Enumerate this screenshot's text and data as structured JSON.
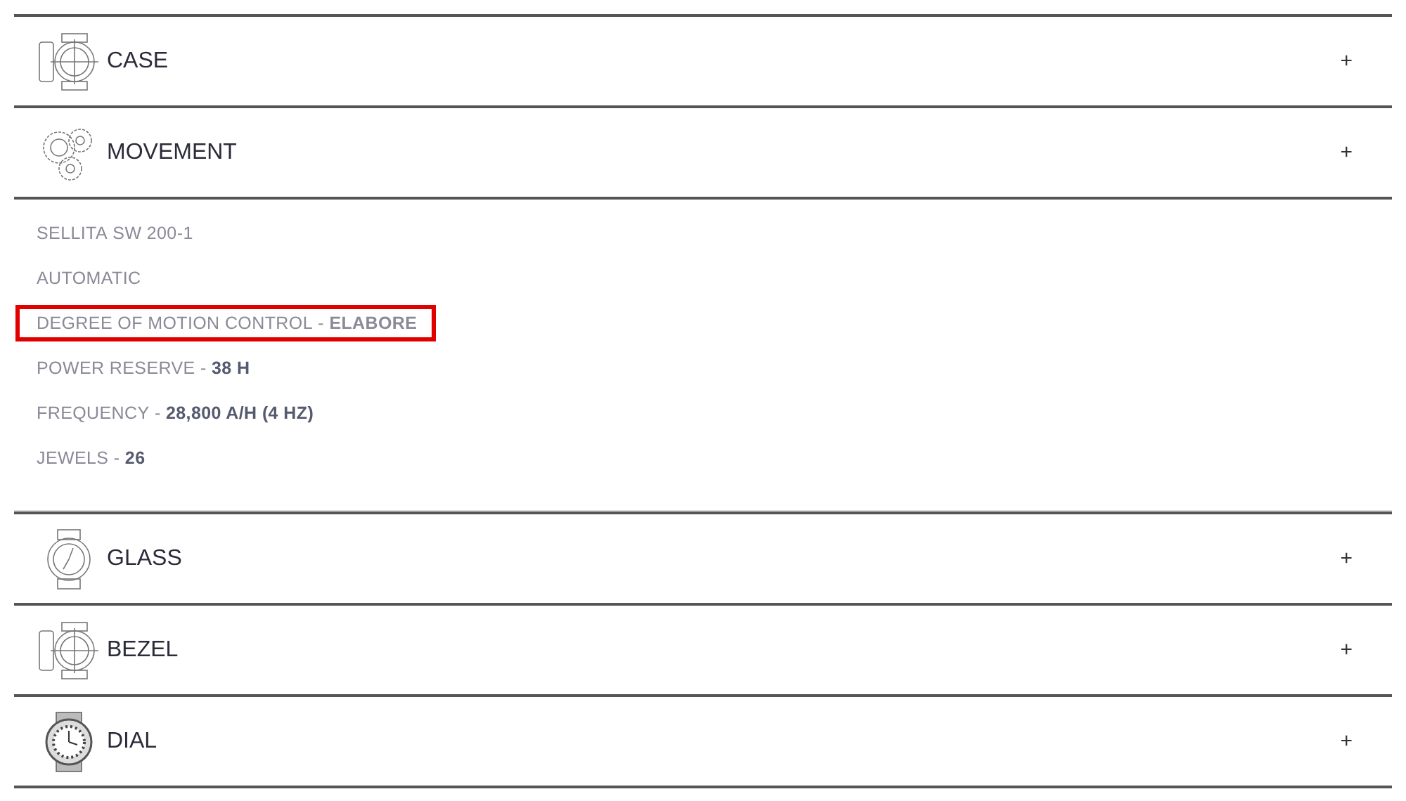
{
  "sections": [
    {
      "title": "CASE",
      "kind": "case",
      "toggle": "+"
    },
    {
      "title": "MOVEMENT",
      "kind": "movement",
      "toggle": "+",
      "details": [
        {
          "label": "SELLITA SW 200-1",
          "highlighted": false
        },
        {
          "label": "AUTOMATIC",
          "highlighted": false
        },
        {
          "label": "DEGREE OF MOTION CONTROL - ",
          "value": "ELABORE",
          "highlighted": true
        },
        {
          "label": "POWER RESERVE - ",
          "value": "38 H",
          "highlighted": false
        },
        {
          "label": "FREQUENCY - ",
          "value": "28,800 A/H (4 HZ)",
          "highlighted": false
        },
        {
          "label": "JEWELS - ",
          "value": "26",
          "highlighted": false
        }
      ]
    },
    {
      "title": "GLASS",
      "kind": "glass",
      "toggle": "+"
    },
    {
      "title": "BEZEL",
      "kind": "case",
      "toggle": "+"
    },
    {
      "title": "DIAL",
      "kind": "dial",
      "toggle": "+"
    }
  ]
}
